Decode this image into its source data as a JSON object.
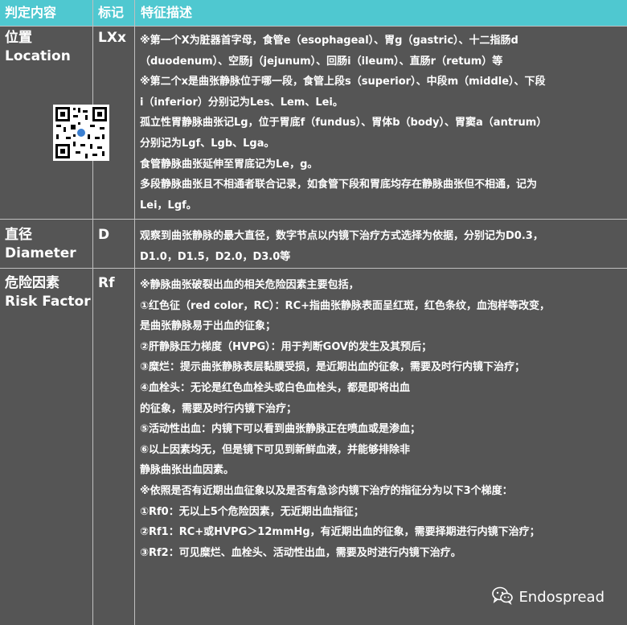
{
  "header": {
    "col1": "判定内容",
    "col2": "标记",
    "col3": "特征描述"
  },
  "rows": [
    {
      "label_cn": "位置",
      "label_en": "Location",
      "mark": "LXx",
      "lines": [
        "※第一个X为脏器首字母，食管e（esophageal）、胃g（gastric）、十二指肠d",
        "（duodenum）、空肠j（jejunum）、回肠i（ileum）、直肠r（retum）等",
        "※第二个x是曲张静脉位于哪一段，食管上段s（superior）、中段m（middle）、下段",
        "i（inferior）分别记为Les、Lem、Lei。",
        "孤立性胃静脉曲张记Lg，位于胃底f（fundus）、胃体b（body）、胃窦a（antrum）",
        "分别记为Lgf、Lgb、Lga。",
        "食管静脉曲张延伸至胃底记为Le，g。",
        "多段静脉曲张且不相通者联合记录，如食管下段和胃底均存在静脉曲张但不相通，记为",
        "Lei，Lgf。"
      ]
    },
    {
      "label_cn": "直径",
      "label_en": "Diameter",
      "mark": "D",
      "lines": [
        "观察到曲张静脉的最大直径，数字节点以内镜下治疗方式选择为依据，分别记为D0.3，",
        "D1.0，D1.5，D2.0，D3.0等"
      ]
    },
    {
      "label_cn": "危险因素",
      "label_en": "Risk Factor",
      "mark": "Rf",
      "lines": [
        "※静脉曲张破裂出血的相关危险因素主要包括，",
        "①红色征（red color，RC）：RC+指曲张静脉表面呈红斑，红色条纹，血泡样等改变，",
        "是曲张静脉易于出血的征象；",
        "②肝静脉压力梯度（HVPG）：用于判断GOV的发生及其预后；",
        "③糜烂：提示曲张静脉表层黏膜受损，是近期出血的征象，需要及时行内镜下治疗；",
        "④血栓头：无论是红色血栓头或白色血栓头，都是即将出血",
        "的征象，需要及时行内镜下治疗；",
        "⑤活动性出血：内镜下可以看到曲张静脉正在喷血或是渗血；",
        "⑥以上因素均无，但是镜下可见到新鲜血液，并能够排除非",
        "静脉曲张出血因素。",
        "※依照是否有近期出血征象以及是否有急诊内镜下治疗的指征分为以下3个梯度：",
        "①Rf0：无以上5个危险因素，无近期出血指征；",
        "②Rf1：RC+或HVPG＞12mmHg，有近期出血的征象，需要择期进行内镜下治疗；",
        "③Rf2：可见糜烂、血栓头、活动性出血，需要及时进行内镜下治疗。"
      ]
    }
  ],
  "watermark": {
    "text": "Endospread",
    "icon": "wechat-icon"
  },
  "qr_icon": "qr-code-icon",
  "colors": {
    "header_bg": "#4fc8d0",
    "body_bg": "#555555",
    "grid": "#bfbfbf",
    "text": "#ffffff"
  }
}
